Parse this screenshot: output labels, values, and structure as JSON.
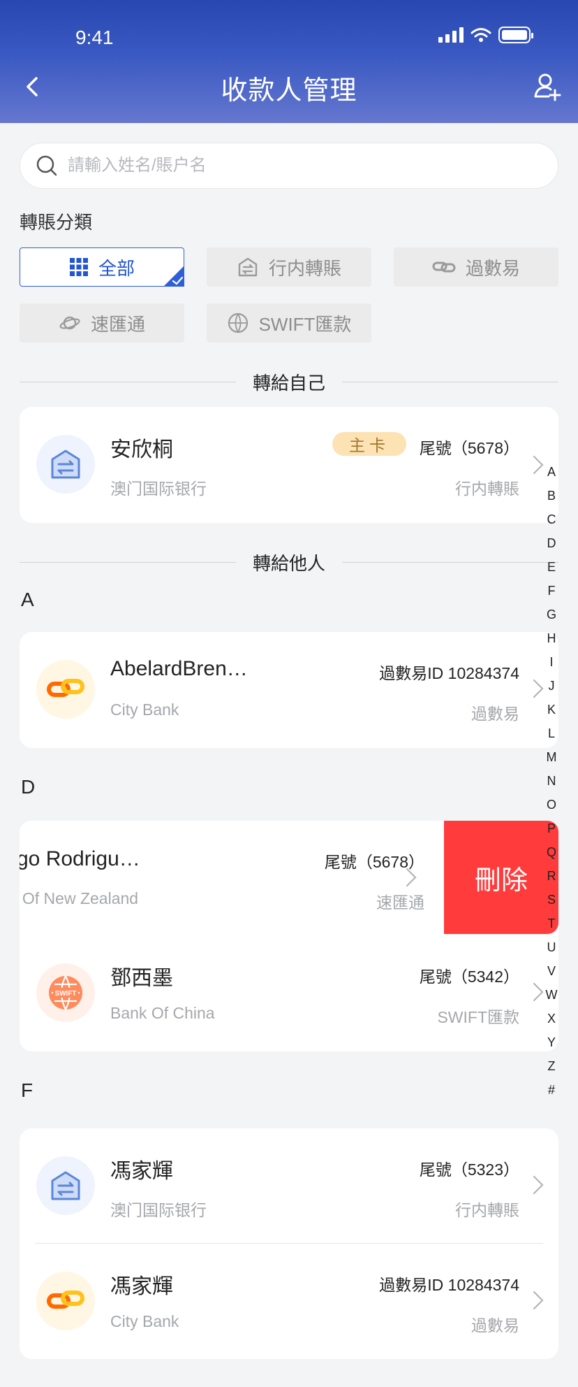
{
  "status": {
    "time": "9:41"
  },
  "header": {
    "title": "收款人管理"
  },
  "search": {
    "placeholder": "請輸入姓名/賬户名"
  },
  "filter": {
    "label": "轉賬分類",
    "chips": [
      {
        "label": "全部",
        "icon": "grid-icon",
        "active": true
      },
      {
        "label": "行内轉賬",
        "icon": "bank-transfer-icon",
        "active": false
      },
      {
        "label": "過數易",
        "icon": "link-icon",
        "active": false
      },
      {
        "label": "速匯通",
        "icon": "planet-icon",
        "active": false
      },
      {
        "label": "SWIFT匯款",
        "icon": "swift-globe-icon",
        "active": false
      }
    ]
  },
  "self_section": {
    "title": "轉給自己",
    "payee": {
      "name": "安欣桐",
      "badge": "主卡",
      "account": "尾號（5678）",
      "bank": "澳门国际银行",
      "type": "行内轉賬",
      "icon": "bank-transfer-icon"
    }
  },
  "others_section": {
    "title": "轉給他人",
    "groups": [
      {
        "letter": "A",
        "payees": [
          {
            "name": "AbelardBren…",
            "account": "過數易ID 10284374",
            "bank": "City Bank",
            "type": "過數易",
            "icon": "link-icon"
          }
        ]
      },
      {
        "letter": "D",
        "payees": [
          {
            "name": "go Rodrigu…",
            "account": "尾號（5678）",
            "bank": "k Of  New Zealand",
            "type": "速匯通",
            "icon": "planet-icon",
            "swiped": true,
            "action": "刪除"
          },
          {
            "name": "鄧西墨",
            "account": "尾號（5342）",
            "bank": "Bank Of China",
            "type": "SWIFT匯款",
            "icon": "swift-globe-icon"
          }
        ]
      },
      {
        "letter": "F",
        "payees": [
          {
            "name": "馮家輝",
            "account": "尾號（5323）",
            "bank": "澳门国际银行",
            "type": "行内轉賬",
            "icon": "bank-transfer-icon"
          },
          {
            "name": "馮家輝",
            "account": "過數易ID 10284374",
            "bank": "City Bank",
            "type": "過數易",
            "icon": "link-icon"
          }
        ]
      }
    ]
  },
  "alphabet_index": [
    "A",
    "B",
    "C",
    "D",
    "E",
    "F",
    "G",
    "H",
    "I",
    "J",
    "K",
    "L",
    "M",
    "N",
    "O",
    "P",
    "Q",
    "R",
    "S",
    "T",
    "U",
    "V",
    "W",
    "X",
    "Y",
    "Z",
    "#"
  ],
  "colors": {
    "header_top": "#2947b0",
    "header_bottom": "#6577cf",
    "accent": "#2155d2",
    "delete": "#ff3b3b",
    "badge_bg": "#fde2b3"
  }
}
